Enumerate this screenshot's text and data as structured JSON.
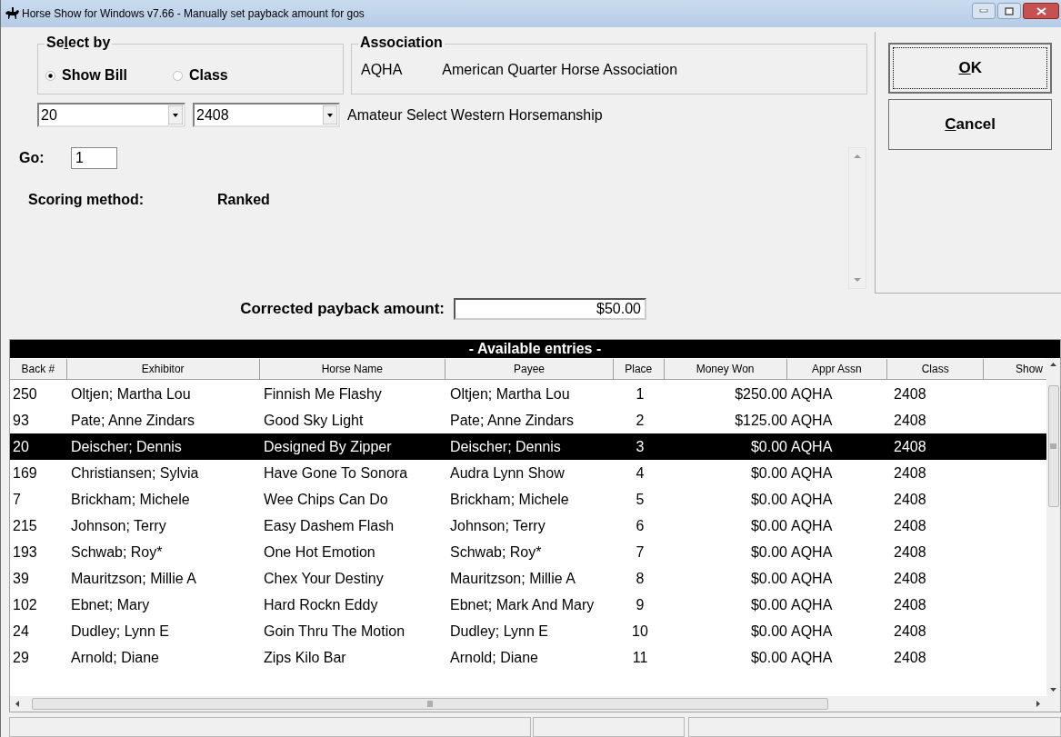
{
  "window": {
    "title": "Horse Show for Windows v7.66 - Manually set payback amount for gos"
  },
  "select_by": {
    "label": [
      {
        "text": "Se",
        "underline": false
      },
      {
        "text": "l",
        "underline": true
      },
      {
        "text": "ect by",
        "underline": false
      }
    ],
    "options": [
      {
        "label": "Show Bill",
        "selected": true
      },
      {
        "label": "Class",
        "selected": false
      }
    ]
  },
  "association": {
    "label": "Association",
    "code": "AQHA",
    "name": "American Quarter Horse Association"
  },
  "show_bill_combo": {
    "value": "20"
  },
  "class_combo": {
    "value": "2408"
  },
  "class_name": "Amateur Select Western Horsemanship",
  "go": {
    "label": "Go:",
    "value": "1"
  },
  "scoring": {
    "label": "Scoring method:",
    "value": "Ranked"
  },
  "corrected_payback": {
    "label": "Corrected payback amount:",
    "value": "$50.00"
  },
  "buttons": [
    {
      "label": [
        {
          "text": "O",
          "underline": true
        },
        {
          "text": "K",
          "underline": false
        }
      ],
      "focused": true
    },
    {
      "label": [
        {
          "text": "C",
          "underline": true
        },
        {
          "text": "ancel",
          "underline": false
        }
      ],
      "focused": false
    }
  ],
  "entries": {
    "title": "- Available entries -",
    "columns": [
      "Back #",
      "Exhibitor",
      "Horse Name",
      "Payee",
      "Place",
      "Money Won",
      "Appr Assn",
      "Class",
      "Show"
    ],
    "rows": [
      {
        "selected": false,
        "cells": [
          "250",
          "Oltjen; Martha Lou",
          "Finnish Me Flashy",
          "Oltjen; Martha Lou",
          "1",
          "$250.00",
          "AQHA",
          "2408"
        ]
      },
      {
        "selected": false,
        "cells": [
          "93",
          "Pate; Anne Zindars",
          "Good Sky Light",
          "Pate; Anne Zindars",
          "2",
          "$125.00",
          "AQHA",
          "2408"
        ]
      },
      {
        "selected": true,
        "cells": [
          "20",
          "Deischer; Dennis",
          "Designed By Zipper",
          "Deischer; Dennis",
          "3",
          "$0.00",
          "AQHA",
          "2408"
        ]
      },
      {
        "selected": false,
        "cells": [
          "169",
          "Christiansen; Sylvia",
          "Have Gone To Sonora",
          "Audra Lynn Show",
          "4",
          "$0.00",
          "AQHA",
          "2408"
        ]
      },
      {
        "selected": false,
        "cells": [
          "7",
          "Brickham; Michele",
          "Wee Chips Can Do",
          "Brickham; Michele",
          "5",
          "$0.00",
          "AQHA",
          "2408"
        ]
      },
      {
        "selected": false,
        "cells": [
          "215",
          "Johnson; Terry",
          "Easy Dashem Flash",
          "Johnson; Terry",
          "6",
          "$0.00",
          "AQHA",
          "2408"
        ]
      },
      {
        "selected": false,
        "cells": [
          "193",
          "Schwab; Roy*",
          "One Hot Emotion",
          "Schwab; Roy*",
          "7",
          "$0.00",
          "AQHA",
          "2408"
        ]
      },
      {
        "selected": false,
        "cells": [
          "39",
          "Mauritzson; Millie A",
          "Chex Your Destiny",
          "Mauritzson; Millie A",
          "8",
          "$0.00",
          "AQHA",
          "2408"
        ]
      },
      {
        "selected": false,
        "cells": [
          "102",
          "Ebnet; Mary",
          "Hard Rockn Eddy",
          "Ebnet; Mark And Mary",
          "9",
          "$0.00",
          "AQHA",
          "2408"
        ]
      },
      {
        "selected": false,
        "cells": [
          "24",
          "Dudley; Lynn E",
          "Goin Thru The Motion",
          "Dudley; Lynn E",
          "10",
          "$0.00",
          "AQHA",
          "2408"
        ]
      },
      {
        "selected": false,
        "cells": [
          "29",
          "Arnold; Diane",
          "Zips Kilo Bar",
          "Arnold; Diane",
          "11",
          "$0.00",
          "AQHA",
          "2408"
        ]
      }
    ]
  }
}
